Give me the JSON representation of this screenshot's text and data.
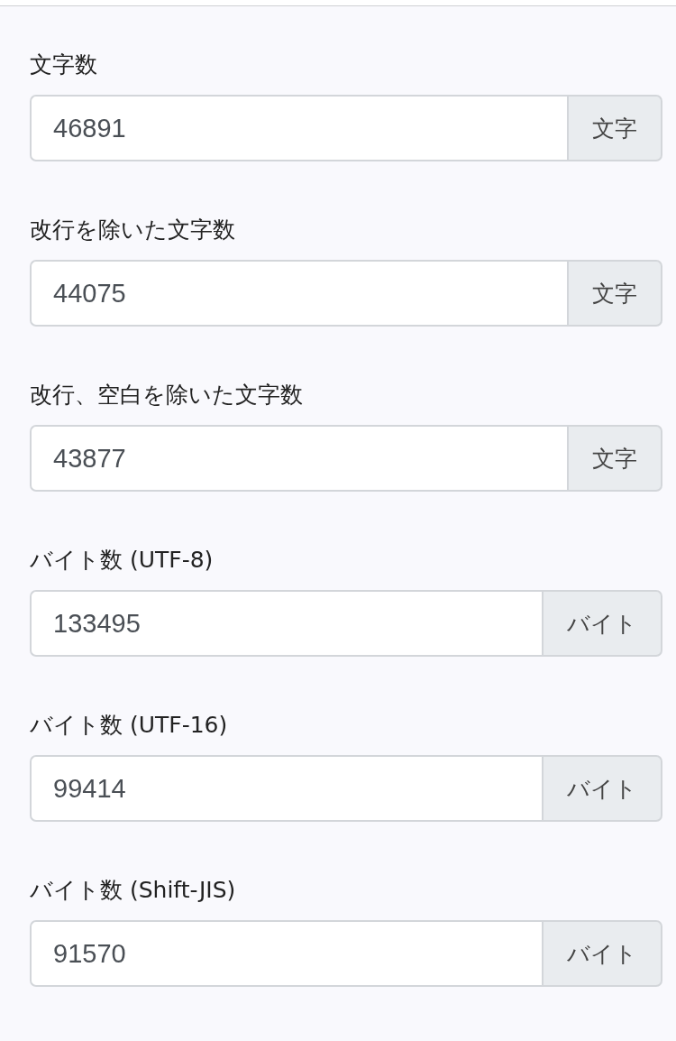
{
  "fields": [
    {
      "label": "文字数",
      "value": "46891",
      "unit": "文字"
    },
    {
      "label": "改行を除いた文字数",
      "value": "44075",
      "unit": "文字"
    },
    {
      "label": "改行、空白を除いた文字数",
      "value": "43877",
      "unit": "文字"
    },
    {
      "label": "バイト数 (UTF-8)",
      "value": "133495",
      "unit": "バイト"
    },
    {
      "label": "バイト数 (UTF-16)",
      "value": "99414",
      "unit": "バイト"
    },
    {
      "label": "バイト数 (Shift-JIS)",
      "value": "91570",
      "unit": "バイト"
    }
  ]
}
